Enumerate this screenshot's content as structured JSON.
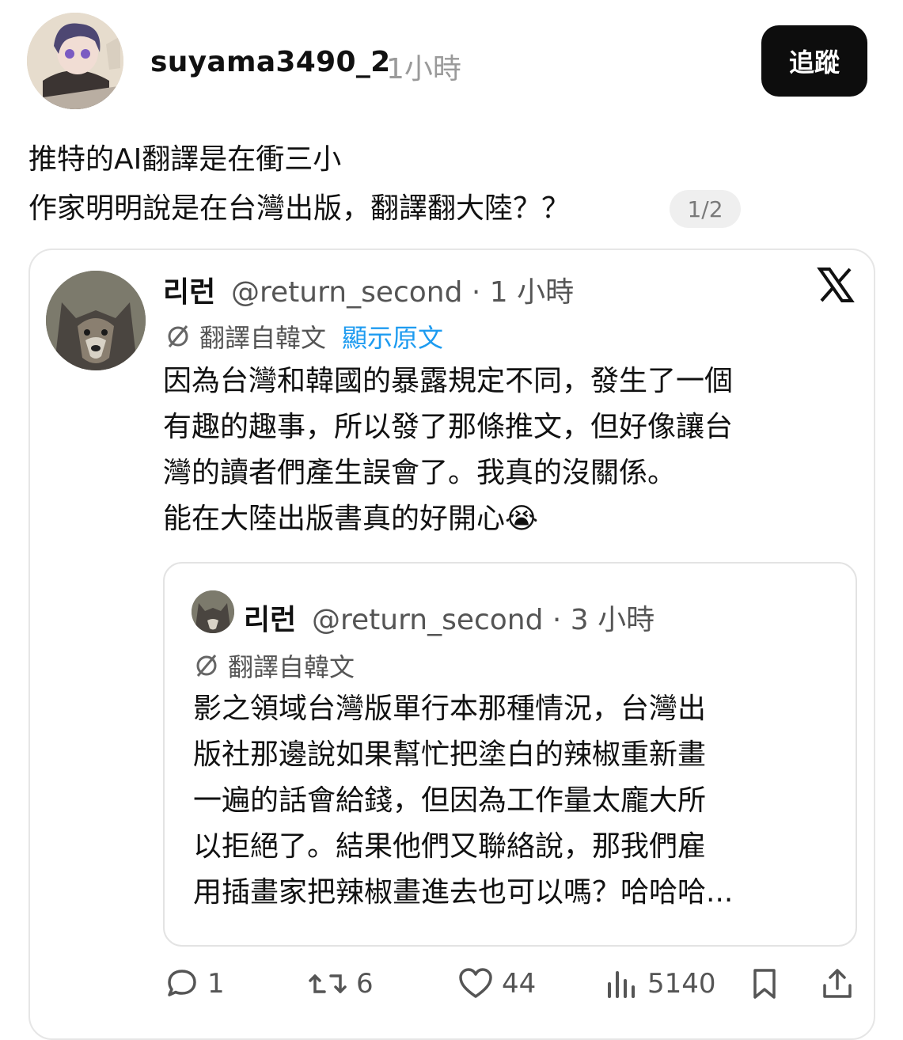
{
  "post": {
    "username": "suyama3490_2",
    "time": "1小時",
    "follow_label": "追蹤",
    "caption_lines": [
      "推特的AI翻譯是在衝三小",
      "作家明明說是在台灣出版，翻譯翻大陸？？"
    ],
    "page_indicator": "1/2"
  },
  "tweet": {
    "name": "리런",
    "handle_time": "@return_second · 1 小時",
    "translated_label": "翻譯自韓文",
    "show_original": "顯示原文",
    "body_lines": [
      "因為台灣和韓國的暴露規定不同，發生了一個",
      "有趣的趣事，所以發了那條推文，但好像讓台",
      "灣的讀者們產生誤會了。我真的沒關係。",
      "能在大陸出版書真的好開心😭"
    ]
  },
  "quote": {
    "name": "리런",
    "handle_time": "@return_second · 3 小時",
    "translated_label": "翻譯自韓文",
    "body_lines": [
      "影之領域台灣版單行本那種情況，台灣出",
      "版社那邊說如果幫忙把塗白的辣椒重新畫",
      "一遍的話會給錢，但因為工作量太龐大所",
      "以拒絕了。結果他們又聯絡說，那我們雇",
      "用插畫家把辣椒畫進去也可以嗎？哈哈哈..."
    ]
  },
  "actions": {
    "comments": "1",
    "reposts": "6",
    "likes": "44",
    "views": "5140"
  },
  "icons": [
    "comment-icon",
    "repost-icon",
    "heart-icon",
    "views-icon",
    "bookmark-icon",
    "share-icon",
    "x-logo-icon",
    "translate-icon"
  ]
}
